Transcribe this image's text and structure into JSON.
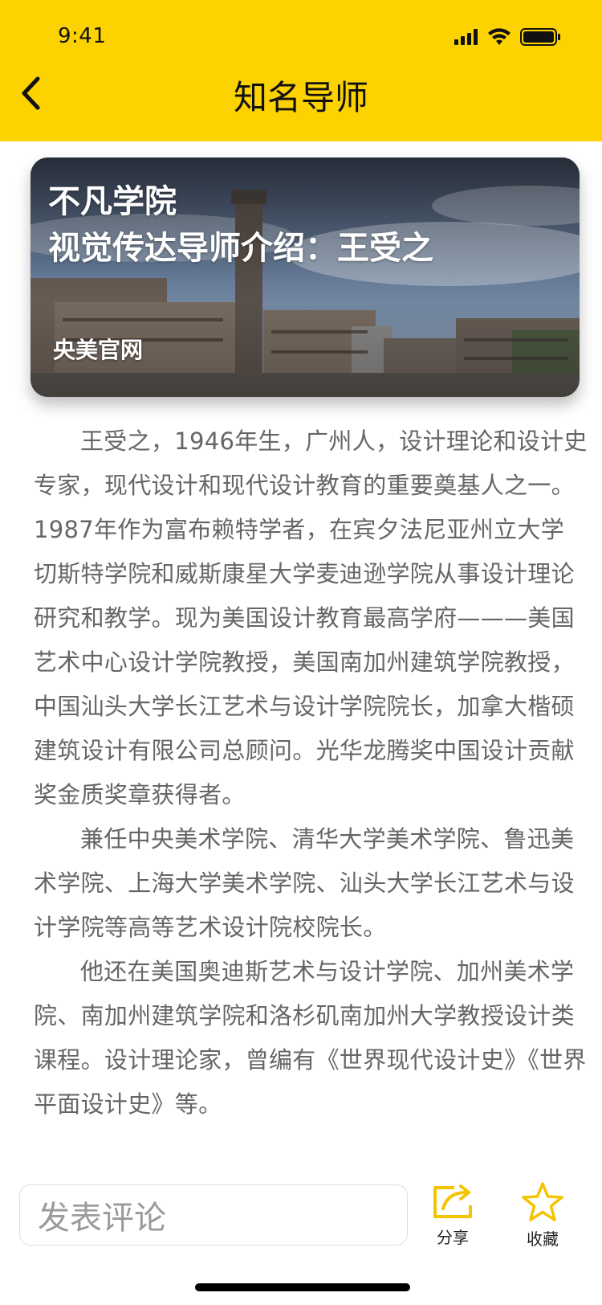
{
  "status_bar": {
    "time": "9:41"
  },
  "nav": {
    "title": "知名导师",
    "back_icon": "chevron-left-icon"
  },
  "hero": {
    "title_line1": "不凡学院",
    "title_line2": "视觉传达导师介绍：王受之",
    "source": "央美官网"
  },
  "article": {
    "paragraphs": [
      "王受之，1946年生，广州人，设计理论和设计史专家，现代设计和现代设计教育的重要奠基人之一。1987年作为富布赖特学者，在宾夕法尼亚州立大学切斯特学院和威斯康星大学麦迪逊学院从事设计理论研究和教学。现为美国设计教育最高学府———美国艺术中心设计学院教授，美国南加州建筑学院教授，中国汕头大学长江艺术与设计学院院长，加拿大楷硕建筑设计有限公司总顾问。光华龙腾奖中国设计贡献奖金质奖章获得者。",
      "兼任中央美术学院、清华大学美术学院、鲁迅美术学院、上海大学美术学院、汕头大学长江艺术与设计学院等高等艺术设计院校院长。",
      "他还在美国奥迪斯艺术与设计学院、加州美术学院、南加州建筑学院和洛杉矶南加州大学教授设计类课程。设计理论家，曾编有《世界现代设计史》《世界平面设计史》等。"
    ]
  },
  "bottom_bar": {
    "comment_placeholder": "发表评论",
    "share_label": "分享",
    "favorite_label": "收藏"
  },
  "colors": {
    "accent": "#FCD200",
    "text": "#666666"
  }
}
